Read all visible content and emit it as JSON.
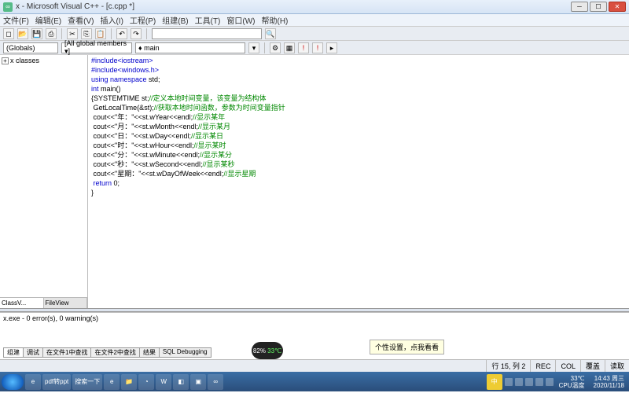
{
  "title": "x - Microsoft Visual C++ - [c.cpp *]",
  "menu": [
    "文件(F)",
    "编辑(E)",
    "查看(V)",
    "插入(I)",
    "工程(P)",
    "组建(B)",
    "工具(T)",
    "窗口(W)",
    "帮助(H)"
  ],
  "combos": {
    "globals": "(Globals)",
    "members": "[All global members ▾]",
    "func": "♦ main"
  },
  "tree": {
    "root": "x classes"
  },
  "sidetabs": {
    "classv": "ClassV...",
    "filev": "FileView"
  },
  "code": {
    "l1a": "#include<iostream>",
    "l2a": "#include<windows.h>",
    "l3a": "using namespace",
    "l3b": " std;",
    "l4a": "int",
    "l4b": " main()",
    "l5a": "{SYSTEMTIME st;",
    "l5c": "//定义本地时间变量，该变量为结构体",
    "l6a": " GetLocalTime(&st);",
    "l6c": "//获取本地时间函数，参数为时间变量指针",
    "l7a": " cout<<\"年：\"<<st.wYear<<endl;",
    "l7c": "//显示某年",
    "l8a": " cout<<\"月：\"<<st.wMonth<<endl;",
    "l8c": "//显示某月",
    "l9a": " cout<<\"日：\"<<st.wDay<<endl;",
    "l9c": "//显示某日",
    "l10a": " cout<<\"时：\"<<st.wHour<<endl;",
    "l10c": "//显示某时",
    "l11a": " cout<<\"分：\"<<st.wMinute<<endl;",
    "l11c": "//显示某分",
    "l12a": " cout<<\"秒：\"<<st.wSecond<<endl;",
    "l12c": "//显示某秒",
    "l13a": " cout<<\"星期：\"<<st.wDayOfWeek<<endl;",
    "l13c": "//显示星期",
    "l14a": " return",
    "l14b": " 0;",
    "l15a": "}"
  },
  "output": {
    "line": "x.exe - 0 error(s), 0 warning(s)"
  },
  "outtabs": [
    "组建",
    "调试",
    "在文件1中查找",
    "在文件2中查找",
    "结果",
    "SQL Debugging"
  ],
  "gauge": {
    "pct": "82%",
    "temp": "33℃",
    "lbl": "CPU温度"
  },
  "tooltip": "个性设置，点我看看",
  "status": {
    "pos": "行 15, 列 2",
    "rec": "REC",
    "col": "COL",
    "ovr": "覆盖",
    "rd": "读取"
  },
  "taskbar": {
    "search": "搜索一下",
    "pdf": "pdf转ppt",
    "ime": "中",
    "temp": "33℃",
    "templ": "CPU温度",
    "time": "14:43 周三",
    "date": "2020/11/18"
  }
}
